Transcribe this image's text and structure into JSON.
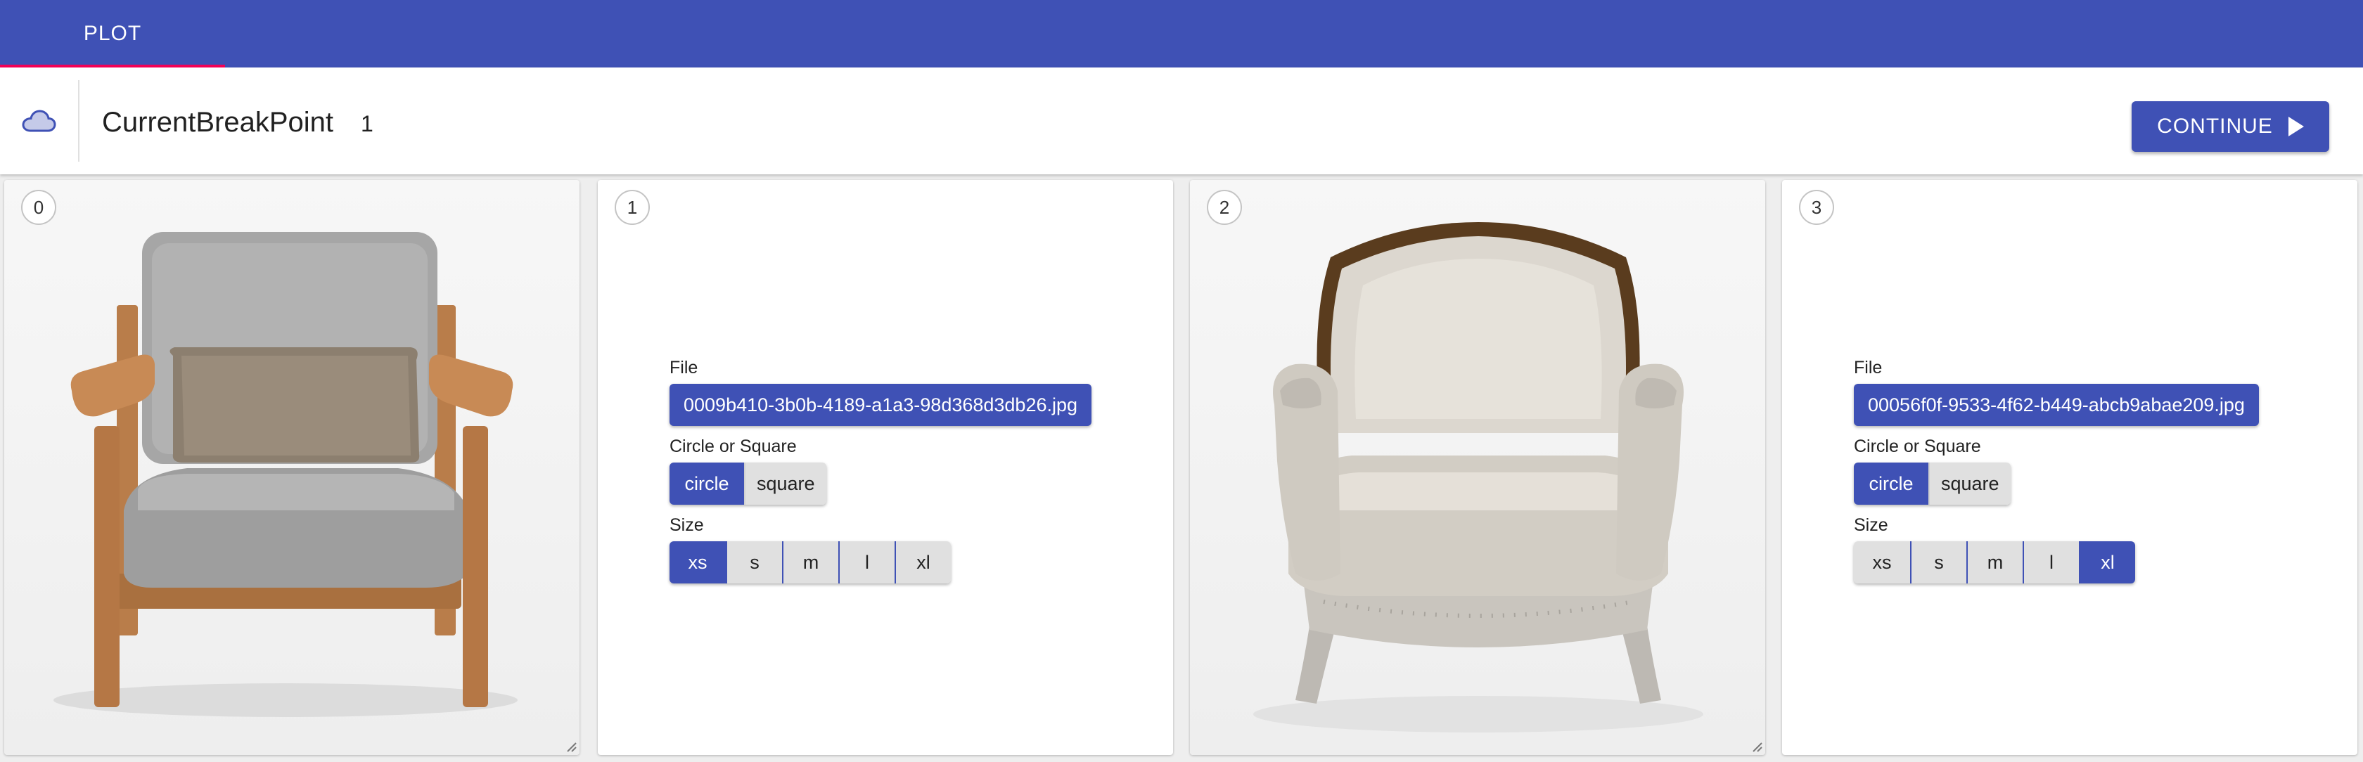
{
  "appbar": {
    "tab_label": "PLOT"
  },
  "toolbar": {
    "cloud_icon": "cloud-icon",
    "breakpoint_label": "CurrentBreakPoint",
    "breakpoint_value": "1",
    "continue_label": "CONTINUE",
    "continue_icon": "play-arrow-icon"
  },
  "panels": [
    {
      "index": "0",
      "kind": "image",
      "image": "armchair-gray-cushion-wooden-frame"
    },
    {
      "index": "1",
      "kind": "form",
      "file_label": "File",
      "file_value": "0009b410-3b0b-4189-a1a3-98d368d3db26.jpg",
      "shape_label": "Circle or Square",
      "shape_options": [
        "circle",
        "square"
      ],
      "shape_selected": "circle",
      "size_label": "Size",
      "size_options": [
        "xs",
        "s",
        "m",
        "l",
        "xl"
      ],
      "size_selected": "xs"
    },
    {
      "index": "2",
      "kind": "image",
      "image": "armchair-cream-leather-carved-frame"
    },
    {
      "index": "3",
      "kind": "form",
      "file_label": "File",
      "file_value": "00056f0f-9533-4f62-b449-abcb9abae209.jpg",
      "shape_label": "Circle or Square",
      "shape_options": [
        "circle",
        "square"
      ],
      "shape_selected": "circle",
      "size_label": "Size",
      "size_options": [
        "xs",
        "s",
        "m",
        "l",
        "xl"
      ],
      "size_selected": "xl"
    }
  ],
  "colors": {
    "primary": "#3f51b5",
    "tab_indicator": "#f50057",
    "unselected": "#e0e0e0"
  }
}
